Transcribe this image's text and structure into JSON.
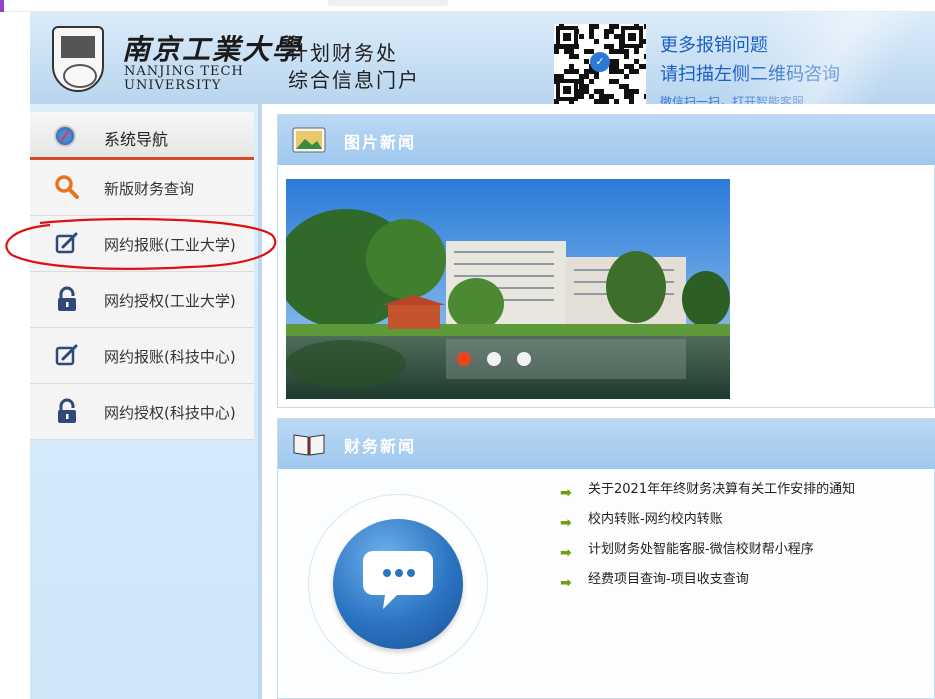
{
  "header": {
    "logo_cn": "南京工業大學",
    "logo_en_line1": "NANJING TECH",
    "logo_en_line2": "UNIVERSITY",
    "dept_line1": "计划财务处",
    "dept_line2": "综合信息门户",
    "qr_line1": "更多报销问题",
    "qr_line2": "请扫描左侧二维码咨询",
    "qr_line3": "微信扫一扫，打开智能客服"
  },
  "sidebar": {
    "title": "系统导航",
    "items": [
      {
        "label": "新版财务查询",
        "icon": "search-icon"
      },
      {
        "label": "网约报账(工业大学)",
        "icon": "edit-icon"
      },
      {
        "label": "网约授权(工业大学)",
        "icon": "lock-icon"
      },
      {
        "label": "网约报账(科技中心)",
        "icon": "edit-icon"
      },
      {
        "label": "网约授权(科技中心)",
        "icon": "lock-icon"
      }
    ]
  },
  "photo_news": {
    "title": "图片新闻",
    "carousel_total": 3,
    "carousel_active": 1
  },
  "finance_news": {
    "title": "财务新闻",
    "items": [
      "关于2021年年终财务决算有关工作安排的通知",
      "校内转账-网约校内转账",
      "计划财务处智能客服-微信校财帮小程序",
      "经费项目查询-项目收支查询"
    ]
  },
  "colors": {
    "accent_red": "#d84b2a",
    "header_blue": "#c6def3",
    "link_blue": "#1a5fc8",
    "arrow_green": "#6aa012"
  }
}
